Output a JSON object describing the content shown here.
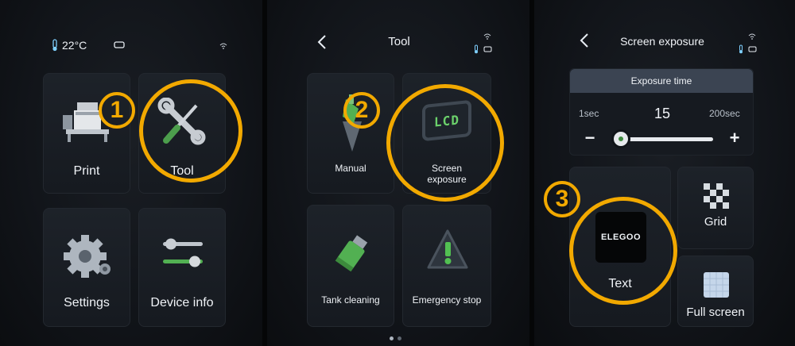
{
  "colors": {
    "accent": "#f2a900",
    "background": "#111419",
    "tile": "#1b1f25"
  },
  "panel1": {
    "temperature": "22°C",
    "tiles": [
      {
        "label": "Print",
        "icon": "printer-icon"
      },
      {
        "label": "Tool",
        "icon": "tools-icon"
      },
      {
        "label": "Settings",
        "icon": "gear-icon"
      },
      {
        "label": "Device info",
        "icon": "sliders-icon"
      }
    ],
    "step_number": "1"
  },
  "panel2": {
    "title": "Tool",
    "tiles": [
      {
        "label": "Manual",
        "icon": "manual-icon"
      },
      {
        "label": "Screen\nexposure",
        "icon": "lcd-icon",
        "icon_text": "LCD"
      },
      {
        "label": "Tank cleaning",
        "icon": "tank-cleaning-icon"
      },
      {
        "label": "Emergency stop",
        "icon": "warning-icon"
      }
    ],
    "step_number": "2",
    "pages": 2,
    "active_page": 1
  },
  "panel3": {
    "title": "Screen exposure",
    "exposure": {
      "header": "Exposure time",
      "min_label": "1sec",
      "max_label": "200sec",
      "value": "15",
      "minus": "−",
      "plus": "+"
    },
    "tiles": [
      {
        "label": "Text",
        "icon": "elegoo-logo",
        "logo_text": "ELEGOO"
      },
      {
        "label": "Grid",
        "icon": "grid-icon"
      },
      {
        "label": "Full screen",
        "icon": "full-screen-icon"
      }
    ],
    "step_number": "3"
  }
}
